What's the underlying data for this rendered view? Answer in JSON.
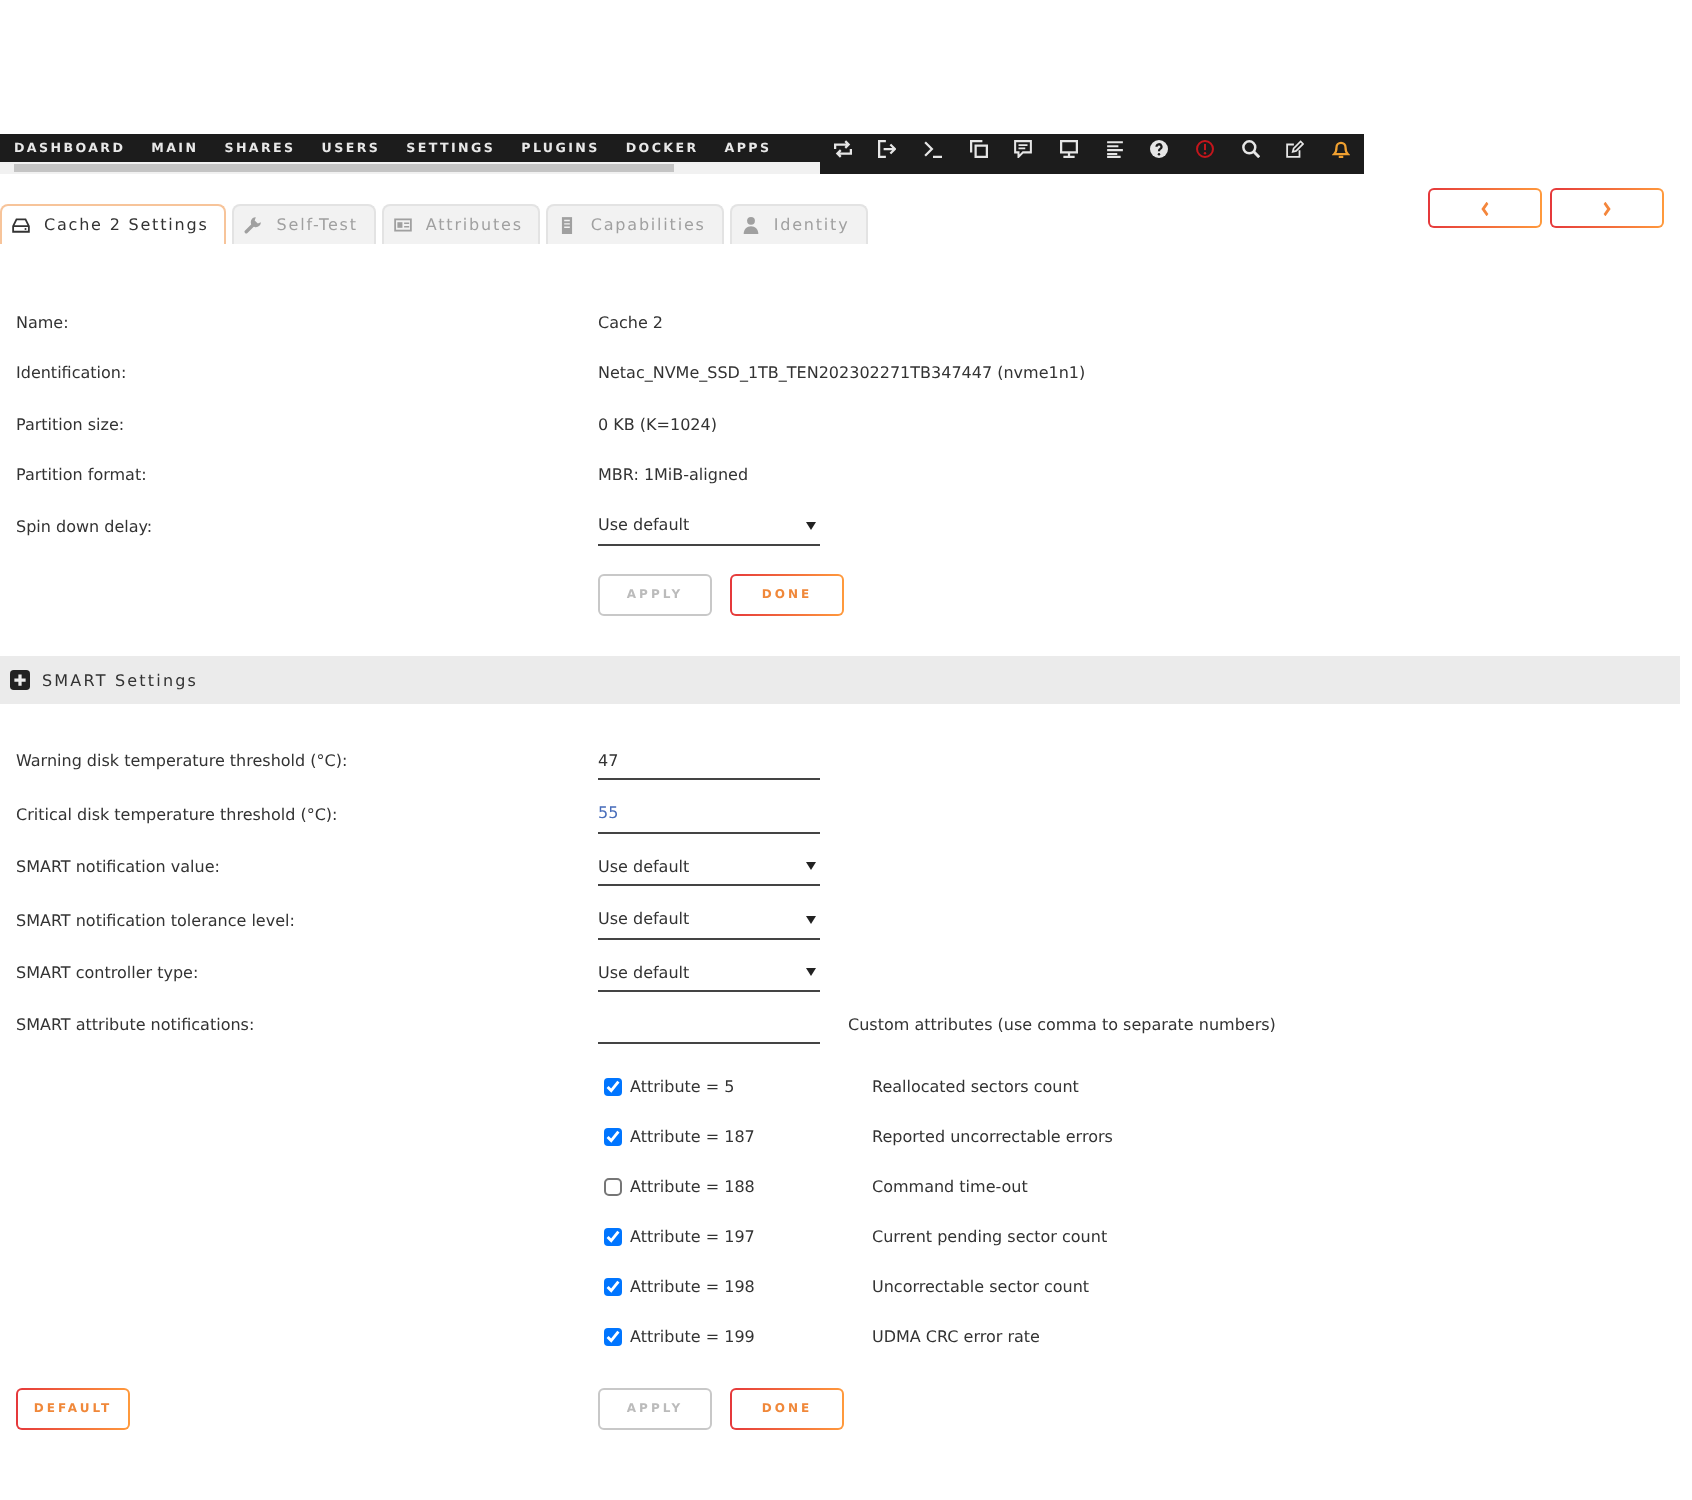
{
  "nav": {
    "items": [
      "DASHBOARD",
      "MAIN",
      "SHARES",
      "USERS",
      "SETTINGS",
      "PLUGINS",
      "DOCKER",
      "APPS"
    ]
  },
  "tabs": [
    {
      "label": "Cache 2 Settings",
      "selected": true
    },
    {
      "label": "Self-Test",
      "selected": false
    },
    {
      "label": "Attributes",
      "selected": false
    },
    {
      "label": "Capabilities",
      "selected": false
    },
    {
      "label": "Identity",
      "selected": false
    }
  ],
  "disk_settings": {
    "fields": [
      {
        "kind": "text",
        "label": "Name:",
        "value": "Cache 2"
      },
      {
        "kind": "text",
        "label": "Identification:",
        "value": "Netac_NVMe_SSD_1TB_TEN202302271TB347447 (nvme1n1)"
      },
      {
        "kind": "text",
        "label": "Partition size:",
        "value": "0 KB (K=1024)"
      },
      {
        "kind": "text",
        "label": "Partition format:",
        "value": "MBR: 1MiB-aligned"
      },
      {
        "kind": "select",
        "label": "Spin down delay:",
        "value": "Use default"
      }
    ],
    "buttons": [
      {
        "label": "APPLY",
        "disabled": true
      },
      {
        "label": "DONE",
        "disabled": false
      }
    ]
  },
  "smart_settings": {
    "title": "SMART Settings",
    "fields": [
      {
        "kind": "input",
        "label": "Warning disk temperature threshold (°C):",
        "value": "47"
      },
      {
        "kind": "input",
        "label": "Critical disk temperature threshold (°C):",
        "placeholder": "55"
      },
      {
        "kind": "select",
        "label": "SMART notification value:",
        "value": "Use default"
      },
      {
        "kind": "select",
        "label": "SMART notification tolerance level:",
        "value": "Use default"
      },
      {
        "kind": "select",
        "label": "SMART controller type:",
        "value": "Use default"
      },
      {
        "kind": "input",
        "label": "SMART attribute notifications:",
        "note": "Custom attributes (use comma to separate numbers)"
      }
    ],
    "attributes": [
      {
        "label": "Attribute = 5",
        "description": "Reallocated sectors count",
        "checked": true
      },
      {
        "label": "Attribute = 187",
        "description": "Reported uncorrectable errors",
        "checked": true
      },
      {
        "label": "Attribute = 188",
        "description": "Command time-out",
        "checked": false
      },
      {
        "label": "Attribute = 197",
        "description": "Current pending sector count",
        "checked": true
      },
      {
        "label": "Attribute = 198",
        "description": "Uncorrectable sector count",
        "checked": true
      },
      {
        "label": "Attribute = 199",
        "description": "UDMA CRC error rate",
        "checked": true
      }
    ],
    "reset_button": {
      "label": "DEFAULT",
      "disabled": false
    },
    "buttons": [
      {
        "label": "APPLY",
        "disabled": true
      },
      {
        "label": "DONE",
        "disabled": false
      }
    ]
  }
}
